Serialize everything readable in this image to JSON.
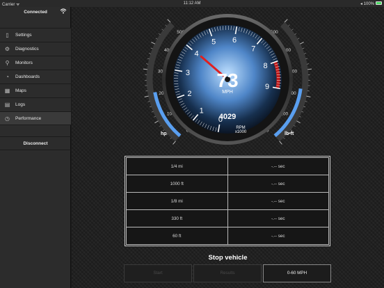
{
  "status_bar": {
    "carrier": "Carrier ᯤ",
    "time": "11:12 AM",
    "battery": "◂ 100%"
  },
  "sidebar": {
    "connection_status": "Connected",
    "items": [
      {
        "label": "Settings",
        "icon": "settings-icon",
        "glyph": "▯"
      },
      {
        "label": "Diagnostics",
        "icon": "engine-icon",
        "glyph": "⚙"
      },
      {
        "label": "Monitors",
        "icon": "magnifier-icon",
        "glyph": "⚲"
      },
      {
        "label": "Dashboards",
        "icon": "gauge-icon",
        "glyph": "◔"
      },
      {
        "label": "Maps",
        "icon": "map-icon",
        "glyph": "▦"
      },
      {
        "label": "Logs",
        "icon": "log-icon",
        "glyph": "▤"
      },
      {
        "label": "Performance",
        "icon": "stopwatch-icon",
        "glyph": "◷"
      }
    ],
    "active_index": 6,
    "disconnect_label": "Disconnect"
  },
  "gauges": {
    "speed": {
      "value": "73",
      "unit": "MPH"
    },
    "rpm": {
      "value": "4029",
      "label": "RPM",
      "multiplier": "x1000",
      "ticks": [
        "0",
        "1",
        "2",
        "3",
        "4",
        "5",
        "6",
        "7",
        "8",
        "9"
      ],
      "needle_value": 4.029,
      "redline_start": 8
    },
    "horsepower": {
      "unit": "hp",
      "ticks": [
        "0",
        "100",
        "200",
        "300",
        "400",
        "500"
      ],
      "max": 500,
      "fill_fraction": 0.42
    },
    "torque": {
      "unit": "lb•ft",
      "ticks": [
        "0",
        "100",
        "200",
        "300",
        "400",
        "500"
      ],
      "max": 500,
      "fill_fraction": 0.45
    },
    "colors": {
      "accent": "#5a9ff0",
      "needle": "#e02020",
      "redline": "#c01818"
    }
  },
  "results": {
    "rows": [
      {
        "distance": "1/4 mi",
        "time": "-.-- sec"
      },
      {
        "distance": "1000 ft",
        "time": "-.-- sec"
      },
      {
        "distance": "1/8 mi",
        "time": "-.-- sec"
      },
      {
        "distance": "330 ft",
        "time": "-.-- sec"
      },
      {
        "distance": "60 ft",
        "time": "-.-- sec"
      }
    ]
  },
  "status_message": "Stop vehicle",
  "buttons": {
    "start": "Start",
    "results": "Results",
    "mode": "0-60 MPH"
  }
}
